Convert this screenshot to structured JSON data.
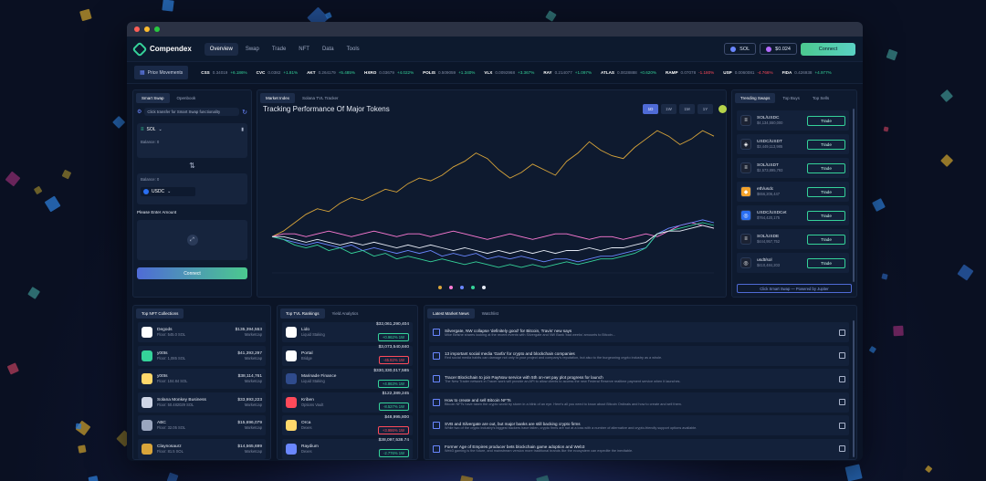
{
  "app": {
    "name": "Compendex",
    "nav": [
      "Overview",
      "Swap",
      "Trade",
      "NFT",
      "Data",
      "Tools"
    ],
    "wallet_token": "SOL",
    "wallet_balance": "$0.024",
    "connect_label": "Connect"
  },
  "ticker": {
    "label": "Price Movements",
    "items": [
      {
        "sym": "CSS",
        "price": "0.34019",
        "chg": "+6.186%",
        "dir": "up"
      },
      {
        "sym": "CVC",
        "price": "0.0382",
        "chg": "+1.81%",
        "dir": "up"
      },
      {
        "sym": "AKT",
        "price": "0.264179",
        "chg": "+5.485%",
        "dir": "up"
      },
      {
        "sym": "HXRO",
        "price": "0.03679",
        "chg": "+4.022%",
        "dir": "up"
      },
      {
        "sym": "POLIS",
        "price": "0.509059",
        "chg": "+1.340%",
        "dir": "up"
      },
      {
        "sym": "VLX",
        "price": "0.0092968",
        "chg": "+3.367%",
        "dir": "up"
      },
      {
        "sym": "RAY",
        "price": "0.214077",
        "chg": "+1.097%",
        "dir": "up"
      },
      {
        "sym": "ATLAS",
        "price": "0.0028888",
        "chg": "+0.620%",
        "dir": "up"
      },
      {
        "sym": "RAMP",
        "price": "0.07078",
        "chg": "-1.180%",
        "dir": "down"
      },
      {
        "sym": "USP",
        "price": "0.0060081",
        "chg": "-4.766%",
        "dir": "down"
      },
      {
        "sym": "FIDA",
        "price": "0.426938",
        "chg": "+4.977%",
        "dir": "up"
      }
    ]
  },
  "swap": {
    "tabs": [
      "Smart Swap",
      "Openbook"
    ],
    "notice": "Click transfer for Smart Swap functionality",
    "from_token": "SOL",
    "balance_label": "Balance: 0",
    "to_token": "USDC",
    "to_balance_label": "Balance: 0",
    "amount_label": "Please Enter Amount",
    "connect_label": "Connect"
  },
  "chart_panel": {
    "tabs": [
      "Market Index",
      "Solana TVL Tracker"
    ],
    "title": "Tracking Performance Of Major Tokens",
    "timeframes": [
      "1D",
      "1W",
      "1M",
      "1Y"
    ]
  },
  "chart_data": {
    "type": "line",
    "title": "Tracking Performance Of Major Tokens",
    "xlabel": "",
    "ylabel": "",
    "grid": false,
    "legend_position": "bottom",
    "series": [
      {
        "color": "#d9a53a",
        "values": [
          0,
          2,
          5,
          8,
          10,
          9,
          12,
          14,
          13,
          15,
          17,
          16,
          19,
          21,
          20,
          22,
          25,
          27,
          30,
          28,
          24,
          21,
          23,
          26,
          24,
          22,
          27,
          30,
          34,
          31,
          29,
          28,
          32,
          35,
          38,
          36,
          33,
          35,
          38,
          36
        ]
      },
      {
        "color": "#ff7bd6",
        "values": [
          0,
          1,
          1,
          0,
          1,
          2,
          1,
          0,
          1,
          2,
          1,
          0,
          1,
          1,
          0,
          1,
          2,
          1,
          0,
          -1,
          0,
          1,
          0,
          -1,
          0,
          1,
          1,
          0,
          -1,
          0,
          0,
          -1,
          0,
          1,
          0,
          2,
          4,
          5,
          4,
          3
        ]
      },
      {
        "color": "#6a87ff",
        "values": [
          0,
          -1,
          -2,
          -3,
          -2,
          -3,
          -4,
          -3,
          -5,
          -4,
          -5,
          -6,
          -5,
          -6,
          -5,
          -7,
          -6,
          -7,
          -6,
          -8,
          -7,
          -8,
          -7,
          -8,
          -9,
          -8,
          -8,
          -9,
          -8,
          -7,
          -7,
          -6,
          -5,
          -4,
          1,
          3,
          4,
          5,
          6,
          5
        ]
      },
      {
        "color": "#35d39a",
        "values": [
          0,
          -1,
          -3,
          -4,
          -3,
          -5,
          -4,
          -6,
          -5,
          -7,
          -6,
          -8,
          -7,
          -8,
          -9,
          -8,
          -9,
          -10,
          -9,
          -10,
          -11,
          -10,
          -11,
          -10,
          -11,
          -10,
          -9,
          -10,
          -9,
          -8,
          -8,
          -7,
          -6,
          -4,
          1,
          2,
          3,
          4,
          5,
          4
        ]
      },
      {
        "color": "#e6ebf5",
        "values": [
          0,
          0,
          -1,
          -2,
          -1,
          -2,
          -3,
          -2,
          -3,
          -2,
          -3,
          -4,
          -3,
          -4,
          -3,
          -4,
          -5,
          -4,
          -5,
          -6,
          -5,
          -6,
          -5,
          -6,
          -5,
          -6,
          -5,
          -5,
          -4,
          -5,
          -4,
          -4,
          -3,
          -2,
          1,
          2,
          2,
          3,
          4,
          3
        ]
      }
    ]
  },
  "swaps": {
    "tabs": [
      "Trending Swaps",
      "Top Buys",
      "Top Sells"
    ],
    "items": [
      {
        "pair": "SOL/USDC",
        "vol": "$4,134,550,000",
        "color": "#1b2233",
        "glyph": "≡"
      },
      {
        "pair": "USDC/USDT",
        "vol": "$3,449,113,985",
        "color": "#1b2233",
        "glyph": "◈"
      },
      {
        "pair": "SOL/USDT",
        "vol": "$2,573,895,793",
        "color": "#1b2233",
        "glyph": "≡"
      },
      {
        "pair": "eth/usdc",
        "vol": "$656,206,447",
        "color": "#f2a22c",
        "glyph": "◆"
      },
      {
        "pair": "USDC/USDCet",
        "vol": "$764,420,175",
        "color": "#2a6ff2",
        "glyph": "◎"
      },
      {
        "pair": "SOL/USDE",
        "vol": "$444,957,752",
        "color": "#1b2233",
        "glyph": "≡"
      },
      {
        "pair": "usdt/sol",
        "vol": "$410,484,203",
        "color": "#1b2233",
        "glyph": "◎"
      }
    ],
    "trade_label": "Trade",
    "footer": "Click Smart Swap — Powered by Jupiter"
  },
  "nft": {
    "tabs": [
      "Top NFT Collections"
    ],
    "items": [
      {
        "name": "Degods",
        "floor": "Floor: 545.0 SOL",
        "val": "$135,394,553",
        "sub": "Marketcap",
        "color": "#ffffff"
      },
      {
        "name": "y00ts",
        "floor": "Floor: 1,085 SOL",
        "val": "$41,393,297",
        "sub": "Marketcap",
        "color": "#35d39a"
      },
      {
        "name": "y00ts",
        "floor": "Floor: 104.84 SOL",
        "val": "$38,114,761",
        "sub": "Marketcap",
        "color": "#ffd86b"
      },
      {
        "name": "Solana Monkey Business",
        "floor": "Floor: 50.482029 SOL",
        "val": "$33,993,223",
        "sub": "Marketcap",
        "color": "#cfd6e6"
      },
      {
        "name": "ABC",
        "floor": "Floor: 32.05 SOL",
        "val": "$15,696,079",
        "sub": "Marketcap",
        "color": "#9aa6bf"
      },
      {
        "name": "Claynosaurz",
        "floor": "Floor: 81.5 SOL",
        "val": "$14,565,699",
        "sub": "Marketcap",
        "color": "#d9a53a"
      }
    ]
  },
  "tvl": {
    "tabs": [
      "Top TVL Rankings",
      "Yield Analytics"
    ],
    "items": [
      {
        "name": "Lido",
        "cat": "Liquid Staking",
        "val": "$32,061,290,404",
        "chg": "+0.962% 1W",
        "dir": "up",
        "color": "#ffffff"
      },
      {
        "name": "Portal",
        "cat": "Bridge",
        "val": "$3,073,540,840",
        "chg": "-45.82% 1W",
        "dir": "down",
        "color": "#ffffff"
      },
      {
        "name": "Marinade Finance",
        "cat": "Liquid Staking",
        "val": "$330,330,017,585",
        "chg": "+4.863% 1W",
        "dir": "up",
        "color": "#2f4b8c"
      },
      {
        "name": "Kriben",
        "cat": "Options Vault",
        "val": "$122,389,245",
        "chg": "-8.527% 1W",
        "dir": "up",
        "color": "#ff4a5a"
      },
      {
        "name": "Orca",
        "cat": "Dexes",
        "val": "$48,995,800",
        "chg": "+3.986% 1W",
        "dir": "down",
        "color": "#ffd86b"
      },
      {
        "name": "Raydium",
        "cat": "Dexes",
        "val": "$38,097,538.74",
        "chg": "-2.776% 1W",
        "dir": "up",
        "color": "#6a87ff"
      }
    ]
  },
  "news": {
    "tabs": [
      "Latest Market News",
      "Watchlist"
    ],
    "items": [
      {
        "title": "Silvergate, NW collapse 'definitely good' for Bitcoin, Travis' new says",
        "desc": "Mike Belshe shares looking at the recent events with Silvergate and NW Bank 'bad weeks' amounts to Bitcoin..."
      },
      {
        "title": "13 important social media 'Garfa' for crypto and blockchain companies",
        "desc": "Red social media habits can damage not only to your project and company's reputation, but also to the burgeoning crypto industry as a whole."
      },
      {
        "title": "Tracer Blockchain to join PayNow service with 5th on-net pay plot progress for launch",
        "desc": "The New Trader network in Tracer work will provide an API to allow clients to access the new Federal Reserve realtime payment service when it launches."
      },
      {
        "title": "How to create and sell Bitcoin NFTs",
        "desc": "Bitcoin NFTs have taken the crypto world by storm in a blink of an eye. Here's all you need to know about Bitcoin Ordinals and how to create and sell them."
      },
      {
        "title": "SVB and Silvergate are out, but major banks are still backing crypto firms",
        "desc": "While two of the crypto industry's biggest backers have fallen, crypto firms are not at a loss with a number of alternative and crypto-friendly support options available."
      },
      {
        "title": "Former Age of Empires producer bets blockchain game adoption and Web3",
        "desc": "Web3 gaming is the future, and mainstream version more traditional brands like the ecosystem can expedite the inevitable."
      }
    ]
  }
}
